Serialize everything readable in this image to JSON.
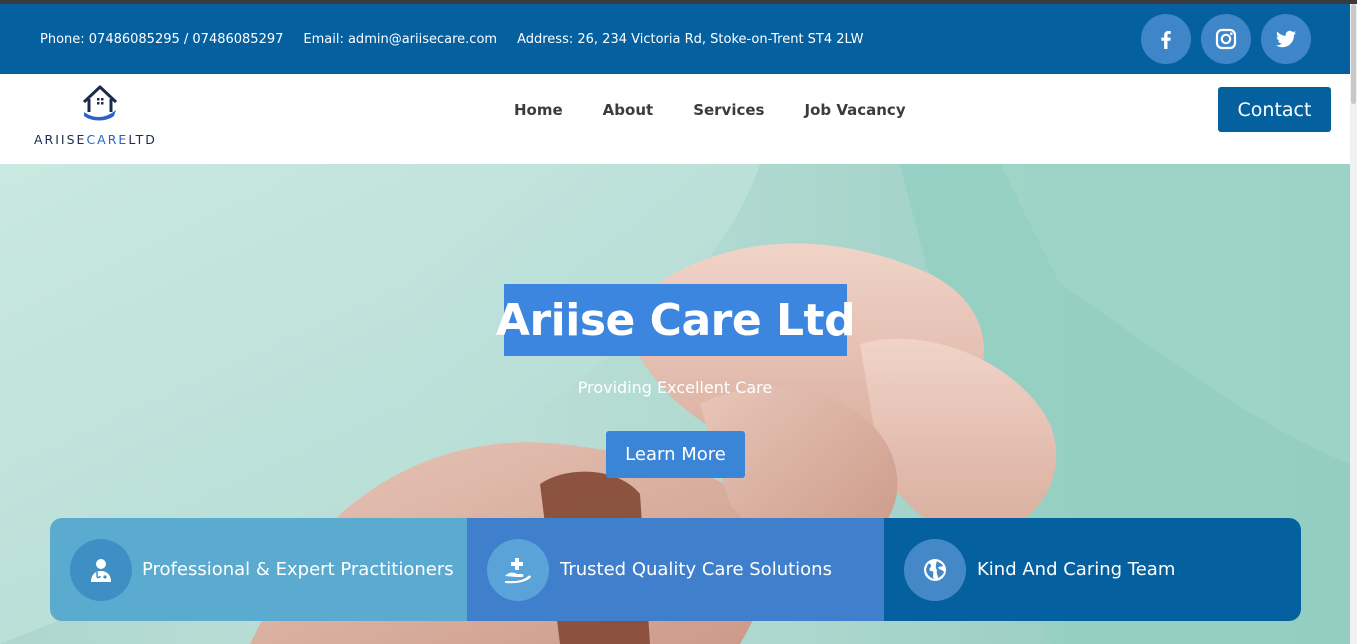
{
  "topbar": {
    "phone": "Phone: 07486085295 / 07486085297",
    "email": "Email: admin@ariisecare.com",
    "address": "Address: 26, 234 Victoria Rd, Stoke-on-Trent ST4 2LW",
    "socials": [
      {
        "icon": "facebook-icon"
      },
      {
        "icon": "instagram-icon"
      },
      {
        "icon": "twitter-icon"
      }
    ]
  },
  "logo": {
    "text_main": "ARIISE",
    "text_accent": "CARE",
    "text_suffix": "LTD"
  },
  "nav": {
    "items": [
      "Home",
      "About",
      "Services",
      "Job Vacancy"
    ],
    "contact_label": "Contact"
  },
  "hero": {
    "title": "Ariise Care Ltd",
    "subtitle": "Providing Excellent Care",
    "button_label": "Learn More"
  },
  "features": [
    {
      "label": "Professional & Expert Practitioners",
      "icon": "doctor-icon"
    },
    {
      "label": "Trusted Quality Care Solutions",
      "icon": "hand-plus-icon"
    },
    {
      "label": "Kind And Caring Team",
      "icon": "globe-icon"
    }
  ],
  "colors": {
    "primary": "#0560a0",
    "accent": "#3d86df",
    "feature_1": "#5aabcf",
    "feature_2": "#3f7fcb",
    "feature_3": "#0560a0"
  }
}
